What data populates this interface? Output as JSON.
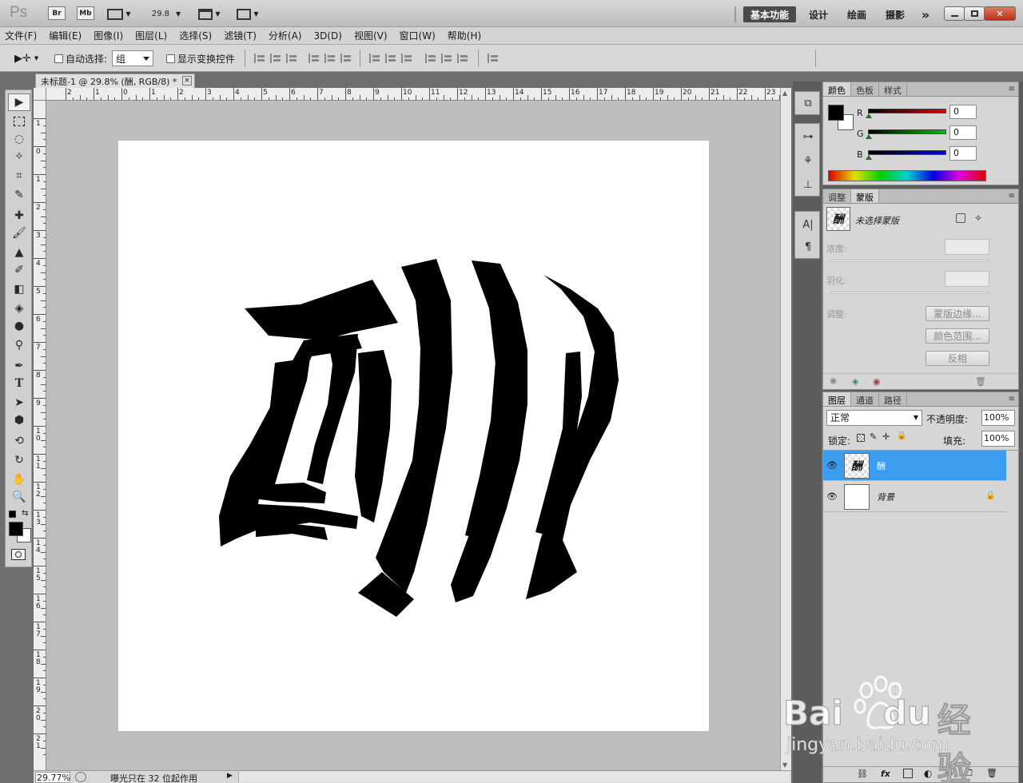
{
  "app": {
    "logo": "Ps",
    "bridge_label": "Br",
    "minibridge_label": "Mb",
    "zoom_value": "29.8",
    "workspaces": [
      "基本功能",
      "设计",
      "绘画",
      "摄影"
    ],
    "more_label": "»"
  },
  "menu": [
    "文件(F)",
    "编辑(E)",
    "图像(I)",
    "图层(L)",
    "选择(S)",
    "滤镜(T)",
    "分析(A)",
    "3D(D)",
    "视图(V)",
    "窗口(W)",
    "帮助(H)"
  ],
  "options": {
    "auto_select_label": "自动选择:",
    "auto_select_value": "组",
    "show_transform_label": "显示变换控件"
  },
  "document": {
    "tab_title": "未标题-1 @ 29.8% (酬, RGB/8) *",
    "close": "×",
    "ruler_h_labels": [
      "2",
      "1",
      "0",
      "1",
      "2",
      "3",
      "4",
      "5",
      "6",
      "7",
      "8",
      "9",
      "10",
      "11",
      "12",
      "13",
      "14",
      "15",
      "16",
      "17",
      "18",
      "19",
      "20",
      "21",
      "22",
      "23"
    ],
    "ruler_v_labels": [
      "1",
      "0",
      "1",
      "2",
      "3",
      "4",
      "5",
      "6",
      "7",
      "8",
      "9",
      "10",
      "11",
      "12",
      "13",
      "14",
      "15",
      "16",
      "17",
      "18",
      "19",
      "20",
      "21"
    ]
  },
  "status": {
    "zoom": "29.77%",
    "message": "曝光只在 32 位起作用"
  },
  "color_panel": {
    "tabs": [
      "颜色",
      "色板",
      "样式"
    ],
    "channels": [
      {
        "label": "R",
        "value": "0",
        "color": "#d40000"
      },
      {
        "label": "G",
        "value": "0",
        "color": "#00b000"
      },
      {
        "label": "B",
        "value": "0",
        "color": "#0000d0"
      }
    ]
  },
  "masks_panel": {
    "tabs": [
      "调整",
      "蒙版"
    ],
    "no_mask": "未选择蒙版",
    "density": "浓度:",
    "feather": "羽化:",
    "adjust": "调整:",
    "buttons": [
      "蒙版边缘...",
      "颜色范围...",
      "反相"
    ]
  },
  "layers_panel": {
    "tabs": [
      "图层",
      "通道",
      "路径"
    ],
    "blend_mode": "正常",
    "opacity_label": "不透明度:",
    "opacity_value": "100%",
    "lock_label": "锁定:",
    "fill_label": "填充:",
    "fill_value": "100%",
    "layers": [
      {
        "name": "酬",
        "selected": true
      },
      {
        "name": "背景",
        "selected": false
      }
    ],
    "footer_fx": "fx"
  },
  "watermark": {
    "brand": "Bai",
    "brand2": "du",
    "brand_cn": "经验",
    "url": "jingyan.baidu.com"
  },
  "colors": {
    "selection_blue": "#3c9cf0",
    "foreground": "#000000",
    "background": "#ffffff"
  }
}
